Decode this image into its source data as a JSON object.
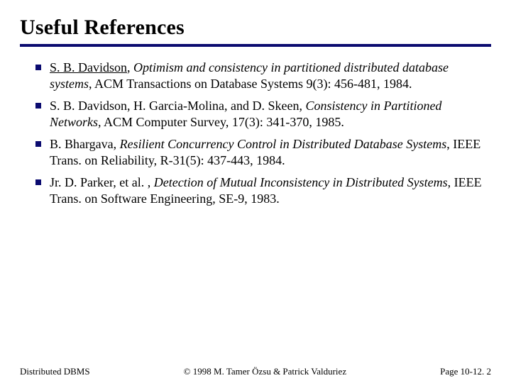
{
  "title": "Useful References",
  "refs": [
    {
      "author": "S. B. Davidson",
      "author_linked": true,
      "sep1": ", ",
      "title_italic": "Optimism and consistency in partitioned distributed database systems",
      "rest": ", ACM Transactions on Database Systems 9(3): 456-481, 1984."
    },
    {
      "author": "S. B. Davidson, H. Garcia-Molina, and D. Skeen",
      "author_linked": false,
      "sep1": ", ",
      "title_italic": "Consistency in Partitioned Networks,",
      "rest": " ACM Computer Survey, 17(3): 341-370, 1985."
    },
    {
      "author": "B. Bhargava",
      "author_linked": false,
      "sep1": ", ",
      "title_italic": "Resilient Concurrency Control in Distributed Database Systems",
      "rest": ", IEEE Trans. on Reliability, R-31(5): 437-443, 1984."
    },
    {
      "author": "Jr. D. Parker, et al.",
      "author_linked": false,
      "sep1": " , ",
      "title_italic": "Detection of Mutual Inconsistency in Distributed Systems",
      "rest": ", IEEE Trans. on Software Engineering, SE-9, 1983."
    }
  ],
  "footer": {
    "left": "Distributed DBMS",
    "center": "© 1998 M. Tamer Özsu & Patrick Valduriez",
    "right": "Page 10-12. 2"
  }
}
